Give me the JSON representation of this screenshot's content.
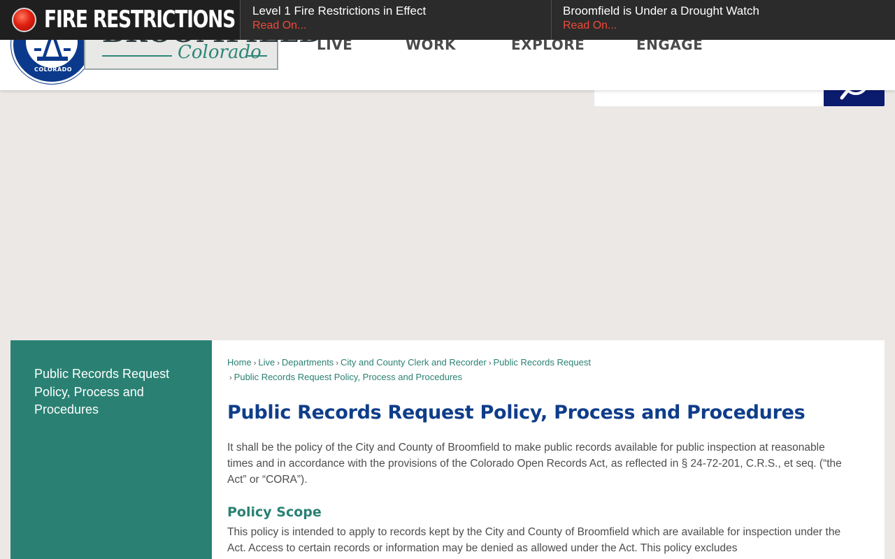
{
  "alerts": {
    "label": "FIRE RESTRICTIONS",
    "items": [
      {
        "headline": "Level 1 Fire Restrictions in Effect",
        "link": "Read On..."
      },
      {
        "headline": "Broomfield is Under a Drought Watch",
        "link": "Read On..."
      }
    ],
    "colors": {
      "bar": "#2b2b2b",
      "link": "#f04a3a",
      "dot": "#e02010"
    }
  },
  "logo": {
    "wordmark": "BROOMFIELD",
    "script": "Colorado",
    "seal_text": "COLORADO"
  },
  "nav": {
    "items": [
      "LIVE",
      "WORK",
      "EXPLORE",
      "ENGAGE"
    ]
  },
  "search": {
    "placeholder": "",
    "icon": "search-icon"
  },
  "sidebar": {
    "items": [
      {
        "label": "Public Records Request Policy, Process and Procedures"
      }
    ]
  },
  "breadcrumb": {
    "items": [
      "Home",
      "Live",
      "Departments",
      "City and County Clerk and Recorder",
      "Public Records Request",
      "Public Records Request Policy, Process and Procedures"
    ]
  },
  "main": {
    "title": "Public Records Request Policy, Process and Procedures",
    "intro": "It shall be the policy of the City and County of Broomfield to make public records available for public inspection at reasonable times and in accordance with the provisions of the Colorado Open Records Act, as reflected in § 24-72-201, C.R.S., et seq. (“the Act” or “CORA”).",
    "section_heading": "Policy Scope",
    "section_text": "This policy is intended to apply to records kept by the City and County of Broomfield which are available for inspection under the Act.  Access to certain records or information may be denied as allowed under the Act. This policy excludes"
  },
  "colors": {
    "title_blue": "#0f3d8a",
    "teal": "#2a8173",
    "navy_button": "#0b1b6e"
  }
}
